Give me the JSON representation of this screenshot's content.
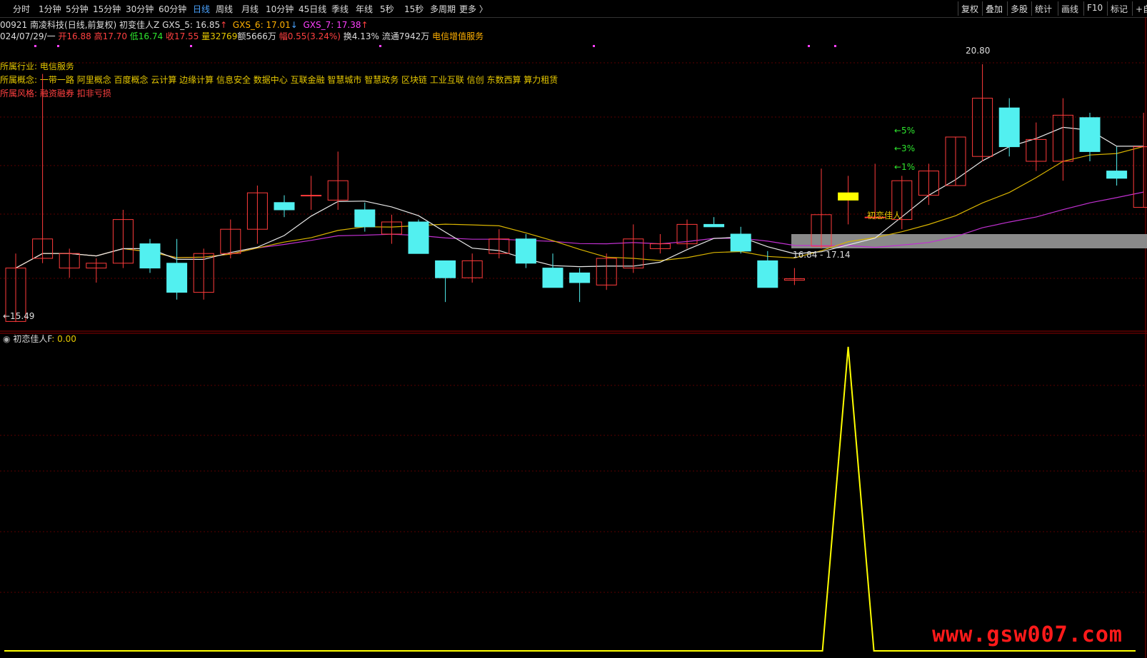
{
  "toolbar": {
    "periods": [
      "分时",
      "1分钟",
      "5分钟",
      "15分钟",
      "30分钟",
      "60分钟",
      "日线",
      "周线",
      "月线",
      "10分钟",
      "45日线",
      "季线",
      "年线",
      "5秒",
      "15秒",
      "多周期",
      "更多 〉"
    ],
    "active_period": "日线",
    "right_buttons": [
      "复权",
      "叠加",
      "多股",
      "统计",
      "画线",
      "F10",
      "标记",
      "+自"
    ]
  },
  "header": {
    "code": "00921",
    "name": "南凌科技",
    "mode": "(日线,前复权)",
    "indicator": "初变佳人Z",
    "gxs5": "GXS_5: 16.85",
    "gxs5_arrow": "↑",
    "gxs6": "GXS_6: 17.01",
    "gxs6_arrow": "↓",
    "gxs7": "GXS_7: 17.38",
    "gxs7_arrow": "↑",
    "date": "024/07/29/一",
    "open": "开16.88",
    "high": "高17.70",
    "low": "低16.74",
    "close": "收17.55",
    "volume": "量32769",
    "amount": "额5666万",
    "change": "幅0.55(3.24%)",
    "turnover": "换4.13%",
    "float": "流通7942万",
    "sector": "电信增值服务"
  },
  "annotations": {
    "industry_label": "所属行业:",
    "industry_value": "电信服务",
    "concept_label": "所属概念:",
    "concept_value": "一带一路 阿里概念 百度概念 云计算 边缘计算 信息安全 数据中心 互联金融 智慧城市 智慧政务 区块链 工业互联 信创 东数西算 算力租赁",
    "style_label": "所属风格:",
    "style_value": "融资融券 扣非亏损",
    "high_marker": "20.80",
    "low_marker": "←15.49",
    "pct5": "←5%",
    "pct3": "←3%",
    "pct1": "←1%",
    "signal_label": "初恋佳人",
    "range_label": "16.84 - 17.14"
  },
  "sub_panel": {
    "label": "初恋佳人F",
    "value": ": 0.00"
  },
  "watermark": "www.gsw007.com",
  "colors": {
    "up": "#ff3b3b",
    "down": "#52f0f0",
    "ma5": "#e8e8e8",
    "ma10": "#d9b400",
    "ma20": "#c030d0",
    "signal": "#ffff00"
  },
  "chart_data": {
    "type": "candlestick",
    "price_range": [
      15.3,
      21.3
    ],
    "candles": [
      {
        "o": 15.5,
        "h": 16.9,
        "l": 15.49,
        "c": 16.6
      },
      {
        "o": 16.8,
        "h": 20.6,
        "l": 16.7,
        "c": 17.2
      },
      {
        "o": 16.6,
        "h": 17.0,
        "l": 16.4,
        "c": 16.9
      },
      {
        "o": 16.6,
        "h": 16.8,
        "l": 16.3,
        "c": 16.7
      },
      {
        "o": 16.7,
        "h": 17.8,
        "l": 16.6,
        "c": 17.6
      },
      {
        "o": 17.1,
        "h": 17.2,
        "l": 16.5,
        "c": 16.6
      },
      {
        "o": 16.7,
        "h": 17.2,
        "l": 15.95,
        "c": 16.1
      },
      {
        "o": 16.1,
        "h": 17.0,
        "l": 15.95,
        "c": 16.9
      },
      {
        "o": 16.9,
        "h": 17.6,
        "l": 16.8,
        "c": 17.4
      },
      {
        "o": 17.4,
        "h": 18.3,
        "l": 17.1,
        "c": 18.15
      },
      {
        "o": 17.95,
        "h": 18.1,
        "l": 17.65,
        "c": 17.8
      },
      {
        "o": 18.1,
        "h": 18.5,
        "l": 17.8,
        "c": 18.1
      },
      {
        "o": 18.0,
        "h": 19.0,
        "l": 17.8,
        "c": 18.4
      },
      {
        "o": 17.8,
        "h": 17.95,
        "l": 17.35,
        "c": 17.45
      },
      {
        "o": 17.3,
        "h": 17.7,
        "l": 17.1,
        "c": 17.55
      },
      {
        "o": 17.55,
        "h": 17.6,
        "l": 16.9,
        "c": 16.9
      },
      {
        "o": 16.75,
        "h": 16.75,
        "l": 15.9,
        "c": 16.4
      },
      {
        "o": 16.4,
        "h": 16.9,
        "l": 16.3,
        "c": 16.75
      },
      {
        "o": 16.9,
        "h": 17.4,
        "l": 16.8,
        "c": 17.2
      },
      {
        "o": 17.2,
        "h": 17.3,
        "l": 16.6,
        "c": 16.7
      },
      {
        "o": 16.6,
        "h": 16.9,
        "l": 16.2,
        "c": 16.2
      },
      {
        "o": 16.5,
        "h": 16.6,
        "l": 15.9,
        "c": 16.3
      },
      {
        "o": 16.25,
        "h": 16.9,
        "l": 16.15,
        "c": 16.8
      },
      {
        "o": 16.6,
        "h": 17.5,
        "l": 16.5,
        "c": 17.2
      },
      {
        "o": 17.0,
        "h": 17.3,
        "l": 16.9,
        "c": 17.1
      },
      {
        "o": 17.1,
        "h": 17.6,
        "l": 17.0,
        "c": 17.5
      },
      {
        "o": 17.5,
        "h": 17.65,
        "l": 17.45,
        "c": 17.45
      },
      {
        "o": 17.3,
        "h": 17.45,
        "l": 16.9,
        "c": 16.95
      },
      {
        "o": 16.75,
        "h": 16.95,
        "l": 16.2,
        "c": 16.2
      },
      {
        "o": 16.35,
        "h": 16.6,
        "l": 16.25,
        "c": 16.38
      },
      {
        "o": 17.05,
        "h": 18.65,
        "l": 17.0,
        "c": 17.7
      },
      {
        "o": 18.0,
        "h": 18.5,
        "l": 17.5,
        "c": 18.15
      },
      {
        "o": 17.65,
        "h": 18.75,
        "l": 17.6,
        "c": 17.65
      },
      {
        "o": 17.6,
        "h": 18.5,
        "l": 17.4,
        "c": 18.4
      },
      {
        "o": 18.1,
        "h": 18.75,
        "l": 17.9,
        "c": 18.6
      },
      {
        "o": 18.3,
        "h": 19.3,
        "l": 18.3,
        "c": 19.3
      },
      {
        "o": 18.9,
        "h": 20.8,
        "l": 18.8,
        "c": 20.1
      },
      {
        "o": 19.9,
        "h": 20.1,
        "l": 18.9,
        "c": 19.1
      },
      {
        "o": 18.8,
        "h": 19.6,
        "l": 18.6,
        "c": 19.25
      },
      {
        "o": 18.8,
        "h": 20.1,
        "l": 18.4,
        "c": 19.75
      },
      {
        "o": 19.7,
        "h": 19.8,
        "l": 18.8,
        "c": 19.0
      },
      {
        "o": 18.6,
        "h": 19.1,
        "l": 18.3,
        "c": 18.45
      },
      {
        "o": 17.85,
        "h": 19.8,
        "l": 17.85,
        "c": 19.1
      }
    ],
    "signal_series": [
      0,
      0,
      0,
      0,
      0,
      0,
      0,
      0,
      0,
      0,
      0,
      0,
      0,
      0,
      0,
      0,
      0,
      0,
      0,
      0,
      0,
      0,
      0,
      0,
      0,
      0,
      0,
      0,
      0,
      0,
      0,
      1,
      0,
      0,
      0,
      0,
      0,
      0,
      0,
      0,
      0,
      0,
      0
    ]
  }
}
